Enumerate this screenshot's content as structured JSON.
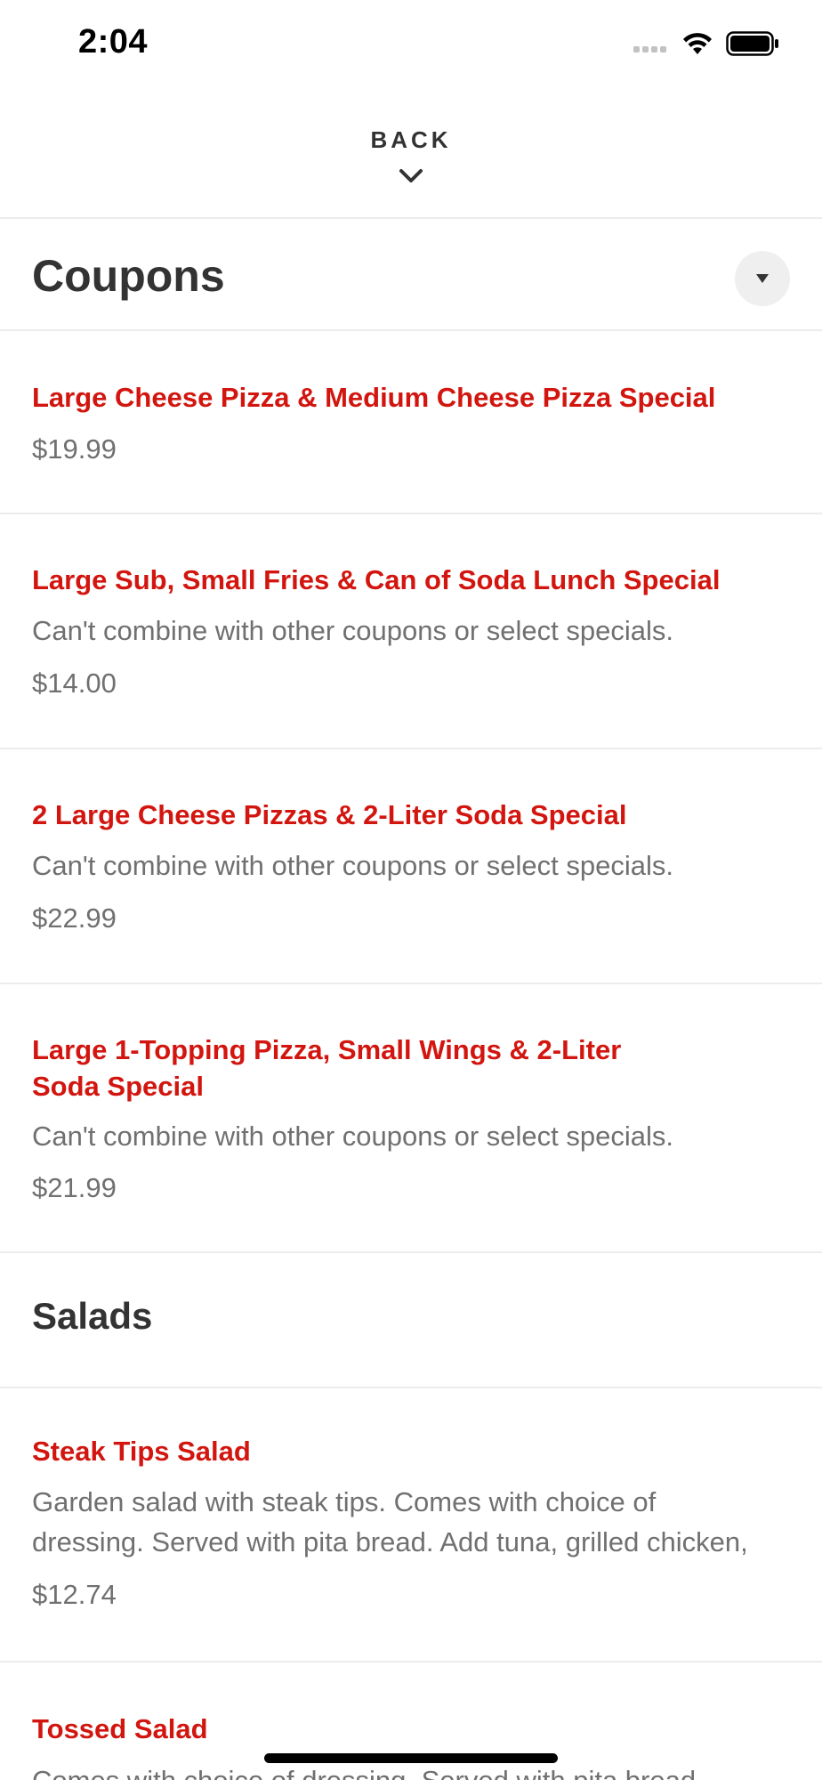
{
  "status_bar": {
    "time": "2:04"
  },
  "header": {
    "back_label": "BACK"
  },
  "sections": {
    "coupons": {
      "title": "Coupons",
      "items": [
        {
          "title": "Large Cheese Pizza & Medium Cheese Pizza Special",
          "price": "$19.99"
        },
        {
          "title": "Large Sub, Small Fries & Can of Soda Lunch Special",
          "description": "Can't combine with other coupons or select specials.",
          "price": "$14.00"
        },
        {
          "title": "2 Large Cheese Pizzas & 2-Liter Soda Special",
          "description": "Can't combine with other coupons or select specials.",
          "price": "$22.99"
        },
        {
          "title_line1": "Large 1-Topping Pizza, Small Wings & 2-Liter",
          "title_line2": "Soda Special",
          "description": "Can't combine with other coupons or select specials.",
          "price": "$21.99"
        }
      ]
    },
    "salads": {
      "title": "Salads",
      "items": [
        {
          "title": "Steak Tips Salad",
          "description_line1": "Garden salad with steak tips. Comes with choice of",
          "description_line2": "dressing. Served with pita bread. Add tuna, grilled chicken,",
          "price": "$12.74"
        },
        {
          "title": "Tossed Salad",
          "description": "Comes with choice of dressing. Served with pita bread."
        }
      ]
    }
  },
  "colors": {
    "accent": "#d2160f",
    "text": "#333333",
    "muted": "#707070",
    "divider": "#ececec"
  },
  "icons": {
    "back": "chevron-down-icon",
    "collapse": "caret-down-icon",
    "wifi": "wifi-icon",
    "battery": "battery-icon",
    "signal": "signal-icon"
  }
}
